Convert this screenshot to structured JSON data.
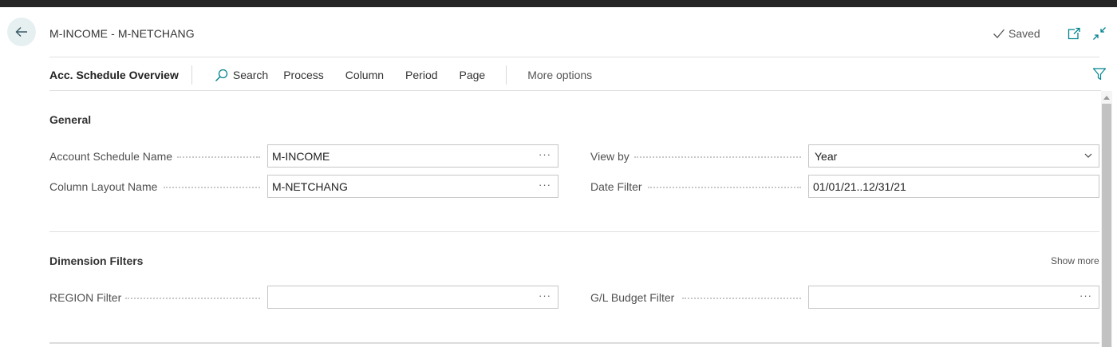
{
  "header": {
    "title": "M-INCOME - M-NETCHANG",
    "saved_label": "Saved",
    "icons": [
      "back-arrow-icon",
      "checkmark-icon",
      "open-new-window-icon",
      "collapse-icon"
    ]
  },
  "actionbar": {
    "title": "Acc. Schedule Overview",
    "search_label": "Search",
    "actions": [
      "Process",
      "Column",
      "Period",
      "Page"
    ],
    "more_label": "More options"
  },
  "general": {
    "title": "General",
    "account_schedule_name": {
      "label": "Account Schedule Name",
      "value": "M-INCOME"
    },
    "column_layout_name": {
      "label": "Column Layout Name",
      "value": "M-NETCHANG"
    },
    "view_by": {
      "label": "View by",
      "value": "Year"
    },
    "date_filter": {
      "label": "Date Filter",
      "value": "01/01/21..12/31/21"
    }
  },
  "dimension_filters": {
    "title": "Dimension Filters",
    "show_more_label": "Show more",
    "region_filter": {
      "label": "REGION Filter",
      "value": ""
    },
    "gl_budget_filter": {
      "label": "G/L Budget Filter",
      "value": ""
    }
  },
  "colors": {
    "accent": "#00838f",
    "back_bg": "#e6f0f1",
    "topbar": "#262626"
  }
}
